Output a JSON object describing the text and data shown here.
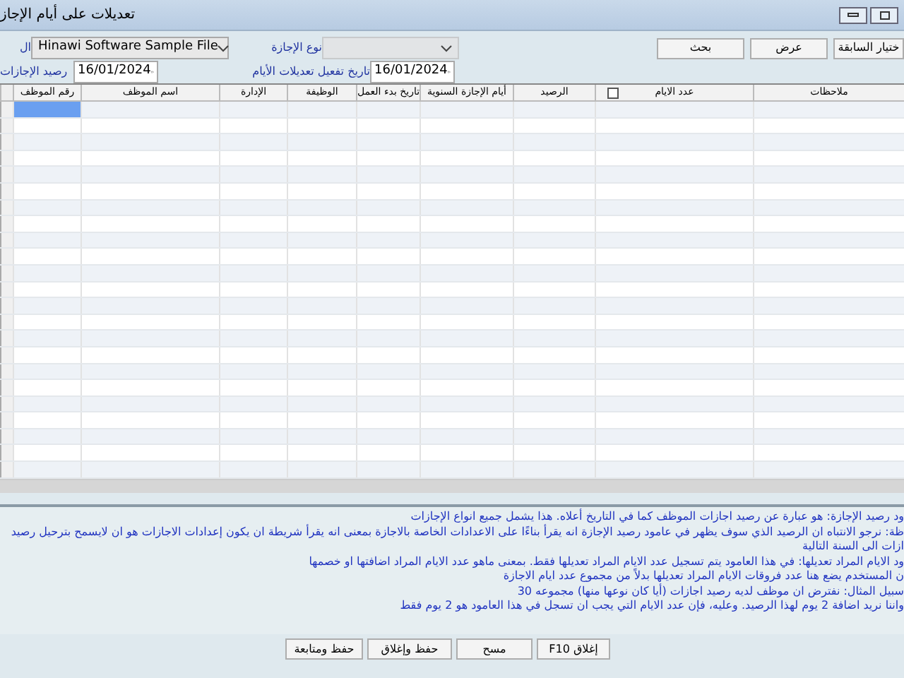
{
  "window": {
    "title": "تعديلات على أيام الإجاز"
  },
  "toolbar": {
    "buttons": [
      {
        "label": "ختيار السابقة"
      },
      {
        "label": "عرض"
      },
      {
        "label": "بحث"
      }
    ]
  },
  "filters": {
    "vacation_type": {
      "disabled": true
    },
    "vacation_type_label": "نوع الإجازة",
    "company": {
      "value": "Hinawi Software Sample File",
      "disabled": false
    },
    "company_label": "ال",
    "activation_date_label": "تاريخ تفعيل تعديلات الأيام",
    "activation_date": "16/01/2024",
    "balance_label": "رصيد الإجازات",
    "balance_date": "16/01/2024"
  },
  "table": {
    "columns": [
      {
        "label": "ملاحظات",
        "kind": "text"
      },
      {
        "label": "عدد الايام",
        "kind": "checkbox",
        "checked": false
      },
      {
        "label": "الرصيد",
        "kind": "text"
      },
      {
        "label": "أيام الإجازة السنوية",
        "kind": "text"
      },
      {
        "label": "تاريخ بدء العمل",
        "kind": "text"
      },
      {
        "label": "الوظيفة",
        "kind": "text"
      },
      {
        "label": "الإدارة",
        "kind": "text"
      },
      {
        "label": "اسم الموظف",
        "kind": "text"
      },
      {
        "label": "رقم الموظف",
        "kind": "text"
      }
    ],
    "rows": [
      {
        "selected": true
      },
      {
        "selected": false
      },
      {
        "selected": false
      },
      {
        "selected": false
      },
      {
        "selected": false
      },
      {
        "selected": false
      },
      {
        "selected": false
      },
      {
        "selected": false
      },
      {
        "selected": false
      },
      {
        "selected": false
      },
      {
        "selected": false
      },
      {
        "selected": false
      },
      {
        "selected": false
      },
      {
        "selected": false
      },
      {
        "selected": false
      },
      {
        "selected": false
      },
      {
        "selected": false
      },
      {
        "selected": false
      },
      {
        "selected": false
      },
      {
        "selected": false
      },
      {
        "selected": false
      },
      {
        "selected": false
      },
      {
        "selected": false
      }
    ]
  },
  "notes": [
    "ود رصيد الإجازة: هو عبارة عن رصيد اجازات الموظف كما في التاريخ أعلاه. هذا يشمل جميع انواع الإجازات",
    "ظة: نرجو الانتباه ان الرصيد الذي سوف يظهر في عامود رصيد الإجازة انه يقرأ بناءًا على الاعدادات الخاصة بالاجازة بمعنى انه يقرأ شريطة ان يكون إعدادات الاجازات هو ان لايسمح بترحيل رصيد",
    "ازات الى السنة التالية",
    "ود الايام المراد تعديلها: في هذا العامود يتم تسجيل عدد الايام المراد تعديلها فقط. بمعنى  ماهو عدد الايام المراد اضافتها او خصمها",
    "ن المستخدم يضع هنا عدد فروقات الايام المراد تعديلها بدلاً من مجموع عدد ايام الاجازة",
    "سبيل المثال: نفترض ان موظف لديه رصيد اجازات (أيا كان نوعها منها) مجموعه 30",
    "واننا نريد اضافة 2 يوم لهذا الرصيد. وعليه، فإن عدد الايام التي يجب ان تسجل في هذا العامود هو 2 يوم فقط"
  ],
  "footer_buttons": [
    {
      "label": "F10 إغلاق"
    },
    {
      "label": "مسح"
    },
    {
      "label": "حفظ وإغلاق"
    },
    {
      "label": "حفظ ومتابعة"
    }
  ]
}
